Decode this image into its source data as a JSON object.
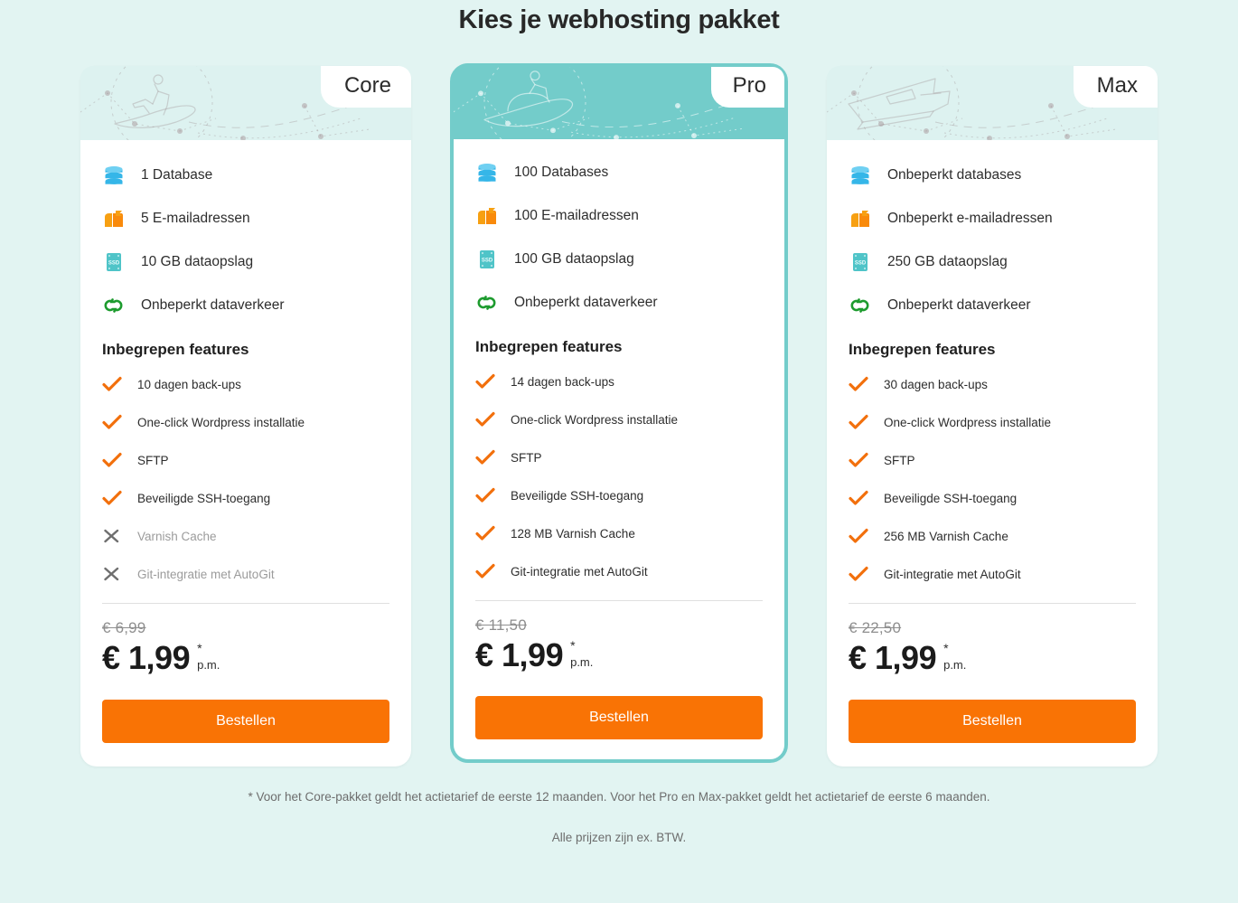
{
  "page": {
    "title": "Kies je webhosting pakket",
    "background_color": "#e2f4f2",
    "accent_color": "#73ccca",
    "cta_color": "#f97305"
  },
  "plans": [
    {
      "tab": "Core",
      "illustration": "surfer-icon",
      "featured": false,
      "specs": [
        {
          "icon": "database-icon",
          "label": "1 Database"
        },
        {
          "icon": "mailbox-icon",
          "label": "5 E-mailadressen"
        },
        {
          "icon": "ssd-drive-icon",
          "label": "10 GB dataopslag"
        },
        {
          "icon": "infinity-traffic-icon",
          "label": "Onbeperkt dataverkeer"
        }
      ],
      "features_title": "Inbegrepen features",
      "features": [
        {
          "label": "10 dagen back-ups",
          "included": true
        },
        {
          "label": "One-click Wordpress installatie",
          "included": true
        },
        {
          "label": "SFTP",
          "included": true
        },
        {
          "label": "Beveiligde SSH-toegang",
          "included": true
        },
        {
          "label": "Varnish Cache",
          "included": false
        },
        {
          "label": "Git-integratie met AutoGit",
          "included": false
        }
      ],
      "old_price": "€ 6,99",
      "new_price": "€ 1,99",
      "price_star": "*",
      "price_period": "p.m.",
      "cta": "Bestellen"
    },
    {
      "tab": "Pro",
      "illustration": "jetski-icon",
      "featured": true,
      "specs": [
        {
          "icon": "database-icon",
          "label": "100 Databases"
        },
        {
          "icon": "mailbox-icon",
          "label": "100 E-mailadressen"
        },
        {
          "icon": "ssd-drive-icon",
          "label": "100 GB dataopslag"
        },
        {
          "icon": "infinity-traffic-icon",
          "label": "Onbeperkt dataverkeer"
        }
      ],
      "features_title": "Inbegrepen features",
      "features": [
        {
          "label": "14 dagen back-ups",
          "included": true
        },
        {
          "label": "One-click Wordpress installatie",
          "included": true
        },
        {
          "label": "SFTP",
          "included": true
        },
        {
          "label": "Beveiligde SSH-toegang",
          "included": true
        },
        {
          "label": "128 MB Varnish Cache",
          "included": true
        },
        {
          "label": "Git-integratie met AutoGit",
          "included": true
        }
      ],
      "old_price": "€ 11,50",
      "new_price": "€ 1,99",
      "price_star": "*",
      "price_period": "p.m.",
      "cta": "Bestellen"
    },
    {
      "tab": "Max",
      "illustration": "speedboat-icon",
      "featured": false,
      "specs": [
        {
          "icon": "database-icon",
          "label": "Onbeperkt databases"
        },
        {
          "icon": "mailbox-icon",
          "label": "Onbeperkt e-mailadressen"
        },
        {
          "icon": "ssd-drive-icon",
          "label": "250 GB dataopslag"
        },
        {
          "icon": "infinity-traffic-icon",
          "label": "Onbeperkt dataverkeer"
        }
      ],
      "features_title": "Inbegrepen features",
      "features": [
        {
          "label": "30 dagen back-ups",
          "included": true
        },
        {
          "label": "One-click Wordpress installatie",
          "included": true
        },
        {
          "label": "SFTP",
          "included": true
        },
        {
          "label": "Beveiligde SSH-toegang",
          "included": true
        },
        {
          "label": "256 MB Varnish Cache",
          "included": true
        },
        {
          "label": "Git-integratie met AutoGit",
          "included": true
        }
      ],
      "old_price": "€ 22,50",
      "new_price": "€ 1,99",
      "price_star": "*",
      "price_period": "p.m.",
      "cta": "Bestellen"
    }
  ],
  "footnotes": {
    "line1": "* Voor het Core-pakket geldt het actietarief de eerste 12 maanden. Voor het Pro en Max-pakket geldt het actietarief de eerste 6 maanden.",
    "line2": "Alle prijzen zijn ex. BTW."
  }
}
